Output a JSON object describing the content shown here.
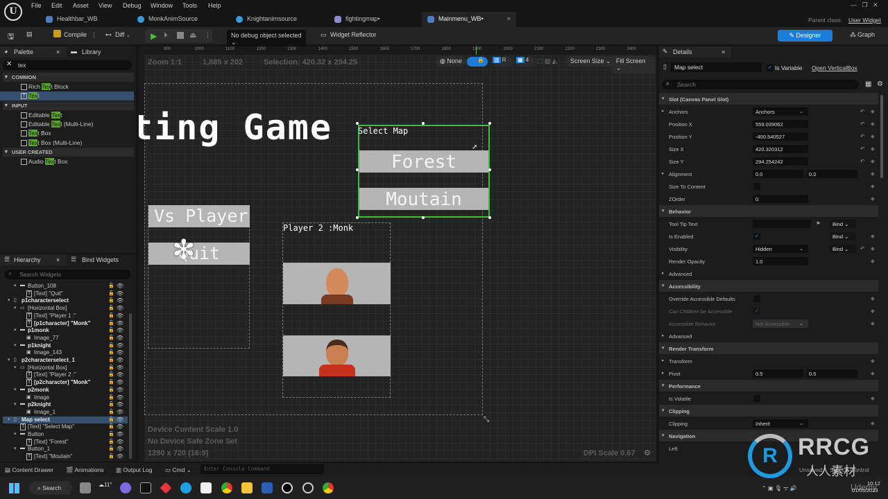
{
  "menu": [
    "File",
    "Edit",
    "Asset",
    "View",
    "Debug",
    "Window",
    "Tools",
    "Help"
  ],
  "tabs": [
    {
      "label": "Healthbar_WB",
      "icon": "widget-blueprint-icon",
      "color": "#4d7ebf"
    },
    {
      "label": "MonkAnimSource",
      "icon": "anim-source-icon",
      "color": "#3a9ad9"
    },
    {
      "label": "Knightanimsource",
      "icon": "anim-source-icon",
      "color": "#3a9ad9"
    },
    {
      "label": "fightingmap•",
      "icon": "level-icon",
      "color": "#8a8ad0"
    },
    {
      "label": "Mainmenu_WB•",
      "icon": "widget-blueprint-icon",
      "color": "#4d7ebf",
      "active": true,
      "close": "×"
    }
  ],
  "parent_class": {
    "label": "Parent class:",
    "value": "User Widget"
  },
  "toolbar": {
    "compile": "Compile",
    "diff": "Diff",
    "debug_object": "No debug object selected",
    "widget_reflector": "Widget Reflector",
    "designer": "Designer",
    "graph": "Graph"
  },
  "palette": {
    "tab": "Palette",
    "library_tab": "Library",
    "close": "×",
    "search_value": "tex",
    "highlight": "#5aa52b",
    "items": [
      {
        "type": "section",
        "label": "COMMON"
      },
      {
        "type": "item",
        "pre": "Rich ",
        "hl": "Tex",
        "post": "t Block",
        "icon": "rich-text-icon"
      },
      {
        "type": "item",
        "pre": "",
        "hl": "Tex",
        "post": "t",
        "icon": "text-icon",
        "selected": true
      },
      {
        "type": "section",
        "label": "INPUT"
      },
      {
        "type": "item",
        "pre": "Editable ",
        "hl": "Tex",
        "post": "t",
        "icon": "editable-text-icon"
      },
      {
        "type": "item",
        "pre": "Editable ",
        "hl": "Tex",
        "post": "t (Multi-Line)",
        "icon": "editable-text-multiline-icon"
      },
      {
        "type": "item",
        "pre": "",
        "hl": "Tex",
        "post": "t Box",
        "icon": "text-box-icon"
      },
      {
        "type": "item",
        "pre": "",
        "hl": "Tex",
        "post": "t Box (Multi-Line)",
        "icon": "text-box-multiline-icon"
      },
      {
        "type": "section",
        "label": "USER CREATED"
      },
      {
        "type": "item",
        "pre": "Audio ",
        "hl": "Tex",
        "post": "t Box",
        "icon": "user-widget-icon"
      }
    ]
  },
  "hierarchy": {
    "tab": "Hierarchy",
    "bind_tab": "Bind Widgets",
    "close": "×",
    "search_placeholder": "Search Widgets",
    "rows": [
      {
        "depth": 2,
        "label": "Button_108",
        "icon": "button",
        "bold": false,
        "exp": true
      },
      {
        "depth": 3,
        "label": "[Text] \"Quit\"",
        "icon": "text"
      },
      {
        "depth": 1,
        "label": "p1characterselect",
        "icon": "vbox",
        "bold": true,
        "exp": true
      },
      {
        "depth": 2,
        "label": "[Horizontal Box]",
        "icon": "hbox",
        "exp": true
      },
      {
        "depth": 3,
        "label": "[Text] \"Player 1 :\"",
        "icon": "text"
      },
      {
        "depth": 3,
        "label": "[p1character] \"Monk\"",
        "icon": "text",
        "bold": true
      },
      {
        "depth": 2,
        "label": "p1monk",
        "icon": "button",
        "bold": true,
        "exp": true
      },
      {
        "depth": 3,
        "label": "Image_77",
        "icon": "image"
      },
      {
        "depth": 2,
        "label": "p1knight",
        "icon": "button",
        "bold": true,
        "exp": true
      },
      {
        "depth": 3,
        "label": "Image_143",
        "icon": "image"
      },
      {
        "depth": 1,
        "label": "p2characterselect_1",
        "icon": "vbox",
        "bold": true,
        "exp": true
      },
      {
        "depth": 2,
        "label": "[Horizontal Box]",
        "icon": "hbox",
        "exp": true
      },
      {
        "depth": 3,
        "label": "[Text] \"Player 2 :\"",
        "icon": "text"
      },
      {
        "depth": 3,
        "label": "[p2character] \"Monk\"",
        "icon": "text",
        "bold": true
      },
      {
        "depth": 2,
        "label": "p2monk",
        "icon": "button",
        "bold": true,
        "exp": true
      },
      {
        "depth": 3,
        "label": "Image",
        "icon": "image"
      },
      {
        "depth": 2,
        "label": "p2knight",
        "icon": "button",
        "bold": true,
        "exp": true
      },
      {
        "depth": 3,
        "label": "Image_1",
        "icon": "image"
      },
      {
        "depth": 1,
        "label": "Map select",
        "icon": "vbox",
        "bold": true,
        "exp": true,
        "selected": true
      },
      {
        "depth": 2,
        "label": "[Text] \"Select Map\"",
        "icon": "text"
      },
      {
        "depth": 2,
        "label": "Button",
        "icon": "button",
        "exp": true
      },
      {
        "depth": 3,
        "label": "[Text] \"Forest\"",
        "icon": "text"
      },
      {
        "depth": 2,
        "label": "Button_1",
        "icon": "button",
        "exp": true
      },
      {
        "depth": 3,
        "label": "[Text] \"Moutain\"",
        "icon": "text"
      }
    ]
  },
  "canvas": {
    "ruler": [
      "900",
      "1000",
      "1100",
      "1200",
      "1300",
      "1400",
      "1500",
      "1600",
      "1700",
      "1800",
      "1900",
      "2000",
      "2100",
      "2200",
      "2300",
      "2400"
    ],
    "zoom": "Zoom 1:1",
    "size": "1,885 x 202",
    "selection": "Selection: 420.32 x 294.25",
    "toolbar": {
      "none": "None",
      "r": "R",
      "grid": "4",
      "screen_size": "Screen Size",
      "fill_screen": "Fill Screen"
    },
    "title": "ting Game",
    "vs_player": "Vs Player",
    "quit": "Quit",
    "player2": "Player 2 :Monk",
    "select_map": "Select Map",
    "forest": "Forest",
    "mountain": "Moutain",
    "device_scale": "Device Content Scale 1.0",
    "safe_zone": "No Device Safe Zone Set",
    "resolution": "1280 x 720 (16:9)",
    "dpi": "DPI Scale 0.67",
    "selection_color": "#3fbf3f"
  },
  "details": {
    "tab": "Details",
    "close": "×",
    "name": "Map select",
    "is_variable": "Is Variable",
    "open_link": "Open VerticalBox",
    "search_placeholder": "Search",
    "rows": [
      {
        "t": "sec",
        "label": "Slot (Canvas Panel Slot)"
      },
      {
        "t": "dd",
        "label": "Anchors",
        "v": "Anchors",
        "arr": true,
        "reset": true
      },
      {
        "t": "num",
        "label": "Position X",
        "v": "559.039062",
        "reset": true
      },
      {
        "t": "num",
        "label": "Position Y",
        "v": "-400.540527",
        "reset": true
      },
      {
        "t": "num",
        "label": "Size X",
        "v": "420.320312",
        "reset": true
      },
      {
        "t": "num",
        "label": "Size Y",
        "v": "294.254242",
        "reset": true
      },
      {
        "t": "num2",
        "label": "Alignment",
        "v": "0.0",
        "v2": "0.0",
        "arr": true
      },
      {
        "t": "chk",
        "label": "Size To Content",
        "v": ""
      },
      {
        "t": "num",
        "label": "ZOrder",
        "v": "0"
      },
      {
        "t": "sec",
        "label": "Behavior"
      },
      {
        "t": "bindtxt",
        "label": "Tool Tip Text",
        "v": "",
        "bind": "Bind"
      },
      {
        "t": "bindchk",
        "label": "Is Enabled",
        "v": "✓",
        "bind": "Bind"
      },
      {
        "t": "binddd",
        "label": "Visibility",
        "v": "Hidden",
        "bind": "Bind",
        "reset": true
      },
      {
        "t": "num",
        "label": "Render Opacity",
        "v": "1.0"
      },
      {
        "t": "adv",
        "label": "Advanced"
      },
      {
        "t": "sec",
        "label": "Accessibility"
      },
      {
        "t": "chk",
        "label": "Override Accessible Defaults",
        "v": ""
      },
      {
        "t": "chk",
        "label": "Can Children be Accessible",
        "v": "✓",
        "dis": true
      },
      {
        "t": "dd",
        "label": "Accessible Behavior",
        "v": "Not Accessible",
        "dis": true
      },
      {
        "t": "adv",
        "label": "Advanced"
      },
      {
        "t": "sec",
        "label": "Render Transform"
      },
      {
        "t": "adv",
        "label": "Transform"
      },
      {
        "t": "num2",
        "label": "Pivot",
        "v": "0.5",
        "v2": "0.5",
        "arr": true
      },
      {
        "t": "sec",
        "label": "Performance"
      },
      {
        "t": "chk",
        "label": "Is Volatile",
        "v": ""
      },
      {
        "t": "sec",
        "label": "Clipping"
      },
      {
        "t": "dd",
        "label": "Clipping",
        "v": "Inherit"
      },
      {
        "t": "sec",
        "label": "Navigation"
      },
      {
        "t": "plain",
        "label": "Left"
      }
    ]
  },
  "bottombar": {
    "content_drawer": "Content Drawer",
    "animations": "Animations",
    "output_log": "Output Log",
    "cmd": "Cmd",
    "console_placeholder": "Enter Console Command",
    "unsaved": "Unsaved",
    "source": "Source Control"
  },
  "taskbar": {
    "search": "Search",
    "weather": "11°",
    "time": "10:12",
    "date": "01/05/2023"
  },
  "watermark": {
    "brand": "RRCG",
    "sub": "人人素材",
    "udemy": "Udemy"
  }
}
